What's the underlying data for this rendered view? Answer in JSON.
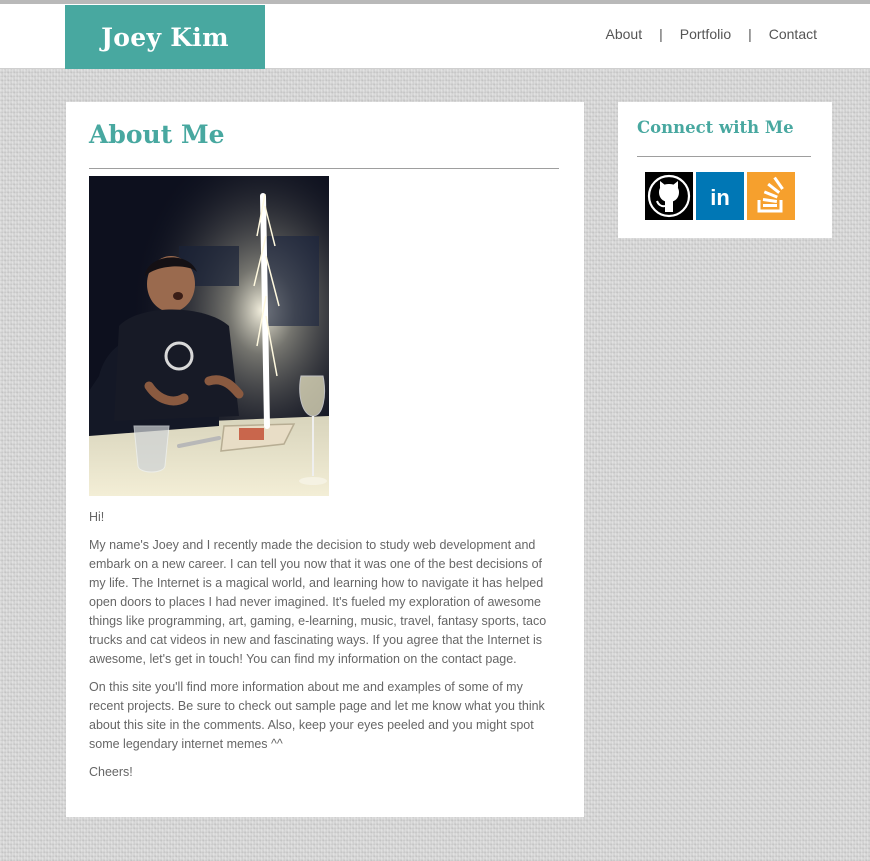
{
  "header": {
    "logo_text": "Joey Kim",
    "nav": [
      "About",
      "Portfolio",
      "Contact"
    ],
    "separator": "|"
  },
  "main": {
    "title": "About Me",
    "photo_icon": "birthday-sparkler-photo",
    "paragraphs": [
      "Hi!",
      "My name's Joey and I recently made the decision to study web development and embark on a new career. I can tell you now that it was one of the best decisions of my life. The Internet is a magical world, and learning how to navigate it has helped open doors to places I had never imagined. It's fueled my exploration of awesome things like programming, art, gaming, e-learning, music, travel, fantasy sports, taco trucks and cat videos in new and fascinating ways. If you agree that the Internet is awesome, let's get in touch! You can find my information on the contact page.",
      "On this site you'll find more information about me and examples of some of my recent projects. Be sure to check out sample page and let me know what you think about this site in the comments. Also, keep your eyes peeled and you might spot some legendary internet memes ^^",
      "Cheers!"
    ]
  },
  "sidebar": {
    "title": "Connect with Me",
    "social": [
      {
        "name": "github-icon",
        "color": "#000000"
      },
      {
        "name": "linkedin-icon",
        "color": "#0077b5",
        "glyph": "in"
      },
      {
        "name": "stackoverflow-icon",
        "color": "#f6a02d"
      }
    ]
  },
  "colors": {
    "accent": "#48a8a0",
    "text": "#666666",
    "nav_text": "#555555"
  }
}
